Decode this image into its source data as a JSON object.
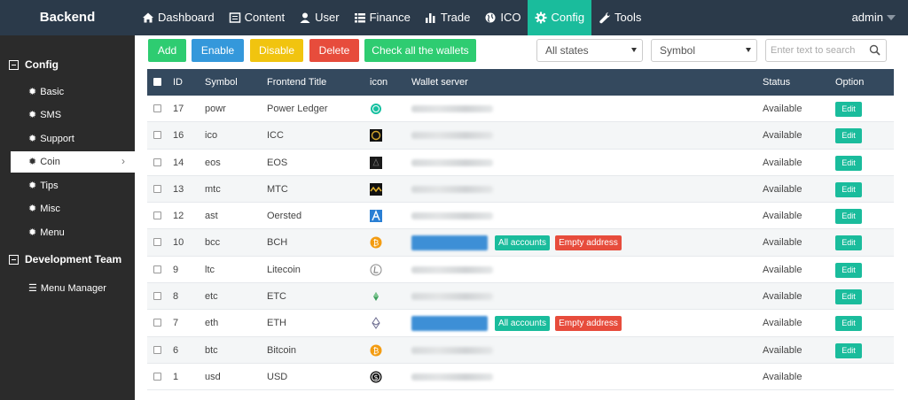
{
  "brand": "Backend",
  "nav": [
    {
      "label": "Dashboard",
      "icon": "home-icon"
    },
    {
      "label": "Content",
      "icon": "list-box-icon"
    },
    {
      "label": "User",
      "icon": "user-icon"
    },
    {
      "label": "Finance",
      "icon": "list-icon"
    },
    {
      "label": "Trade",
      "icon": "bar-chart-icon"
    },
    {
      "label": "ICO",
      "icon": "globe-icon"
    },
    {
      "label": "Config",
      "icon": "gear-icon",
      "active": true
    },
    {
      "label": "Tools",
      "icon": "wrench-icon"
    }
  ],
  "user": "admin",
  "sidebar": {
    "groups": [
      {
        "label": "Config",
        "items": [
          "Basic",
          "SMS",
          "Support",
          "Coin",
          "Tips",
          "Misc",
          "Menu"
        ],
        "active": "Coin"
      },
      {
        "label": "Development Team",
        "items": [
          "Menu Manager"
        ]
      }
    ]
  },
  "toolbar": {
    "add": "Add",
    "enable": "Enable",
    "disable": "Disable",
    "delete": "Delete",
    "check": "Check all the wallets",
    "state_select": "All states",
    "symbol_select": "Symbol",
    "search_placeholder": "Enter text to search"
  },
  "table": {
    "headers": {
      "id": "ID",
      "symbol": "Symbol",
      "title": "Frontend Title",
      "icon": "icon",
      "wallet": "Wallet server",
      "status": "Status",
      "option": "Option"
    },
    "all_accounts_label": "All accounts",
    "empty_address_label": "Empty address",
    "edit_label": "Edit",
    "rows": [
      {
        "id": "17",
        "symbol": "powr",
        "title": "Power Ledger",
        "icon": "power-ledger-icon",
        "status": "Available",
        "wallet_actions": false,
        "edit": true
      },
      {
        "id": "16",
        "symbol": "ico",
        "title": "ICC",
        "icon": "icc-icon",
        "status": "Available",
        "wallet_actions": false,
        "edit": true
      },
      {
        "id": "14",
        "symbol": "eos",
        "title": "EOS",
        "icon": "eos-icon",
        "status": "Available",
        "wallet_actions": false,
        "edit": true
      },
      {
        "id": "13",
        "symbol": "mtc",
        "title": "MTC",
        "icon": "mtc-icon",
        "status": "Available",
        "wallet_actions": false,
        "edit": true
      },
      {
        "id": "12",
        "symbol": "ast",
        "title": "Oersted",
        "icon": "oersted-icon",
        "status": "Available",
        "wallet_actions": false,
        "edit": true
      },
      {
        "id": "10",
        "symbol": "bcc",
        "title": "BCH",
        "icon": "bitcoin-cash-icon",
        "status": "Available",
        "wallet_actions": true,
        "edit": true
      },
      {
        "id": "9",
        "symbol": "ltc",
        "title": "Litecoin",
        "icon": "litecoin-icon",
        "status": "Available",
        "wallet_actions": false,
        "edit": true
      },
      {
        "id": "8",
        "symbol": "etc",
        "title": "ETC",
        "icon": "ethereum-classic-icon",
        "status": "Available",
        "wallet_actions": false,
        "edit": true
      },
      {
        "id": "7",
        "symbol": "eth",
        "title": "ETH",
        "icon": "ethereum-icon",
        "status": "Available",
        "wallet_actions": true,
        "edit": true
      },
      {
        "id": "6",
        "symbol": "btc",
        "title": "Bitcoin",
        "icon": "bitcoin-icon",
        "status": "Available",
        "wallet_actions": false,
        "edit": true
      },
      {
        "id": "1",
        "symbol": "usd",
        "title": "USD",
        "icon": "usd-icon",
        "status": "Available",
        "wallet_actions": false,
        "edit": false
      }
    ]
  },
  "colors": {
    "topbar": "#2b3a4a",
    "accent": "#1abc9c",
    "add": "#2ecc71",
    "enable": "#3498db",
    "disable": "#f1c40f",
    "delete": "#e74c3c",
    "table_header": "#34495e",
    "sidebar": "#2b2b2b"
  }
}
